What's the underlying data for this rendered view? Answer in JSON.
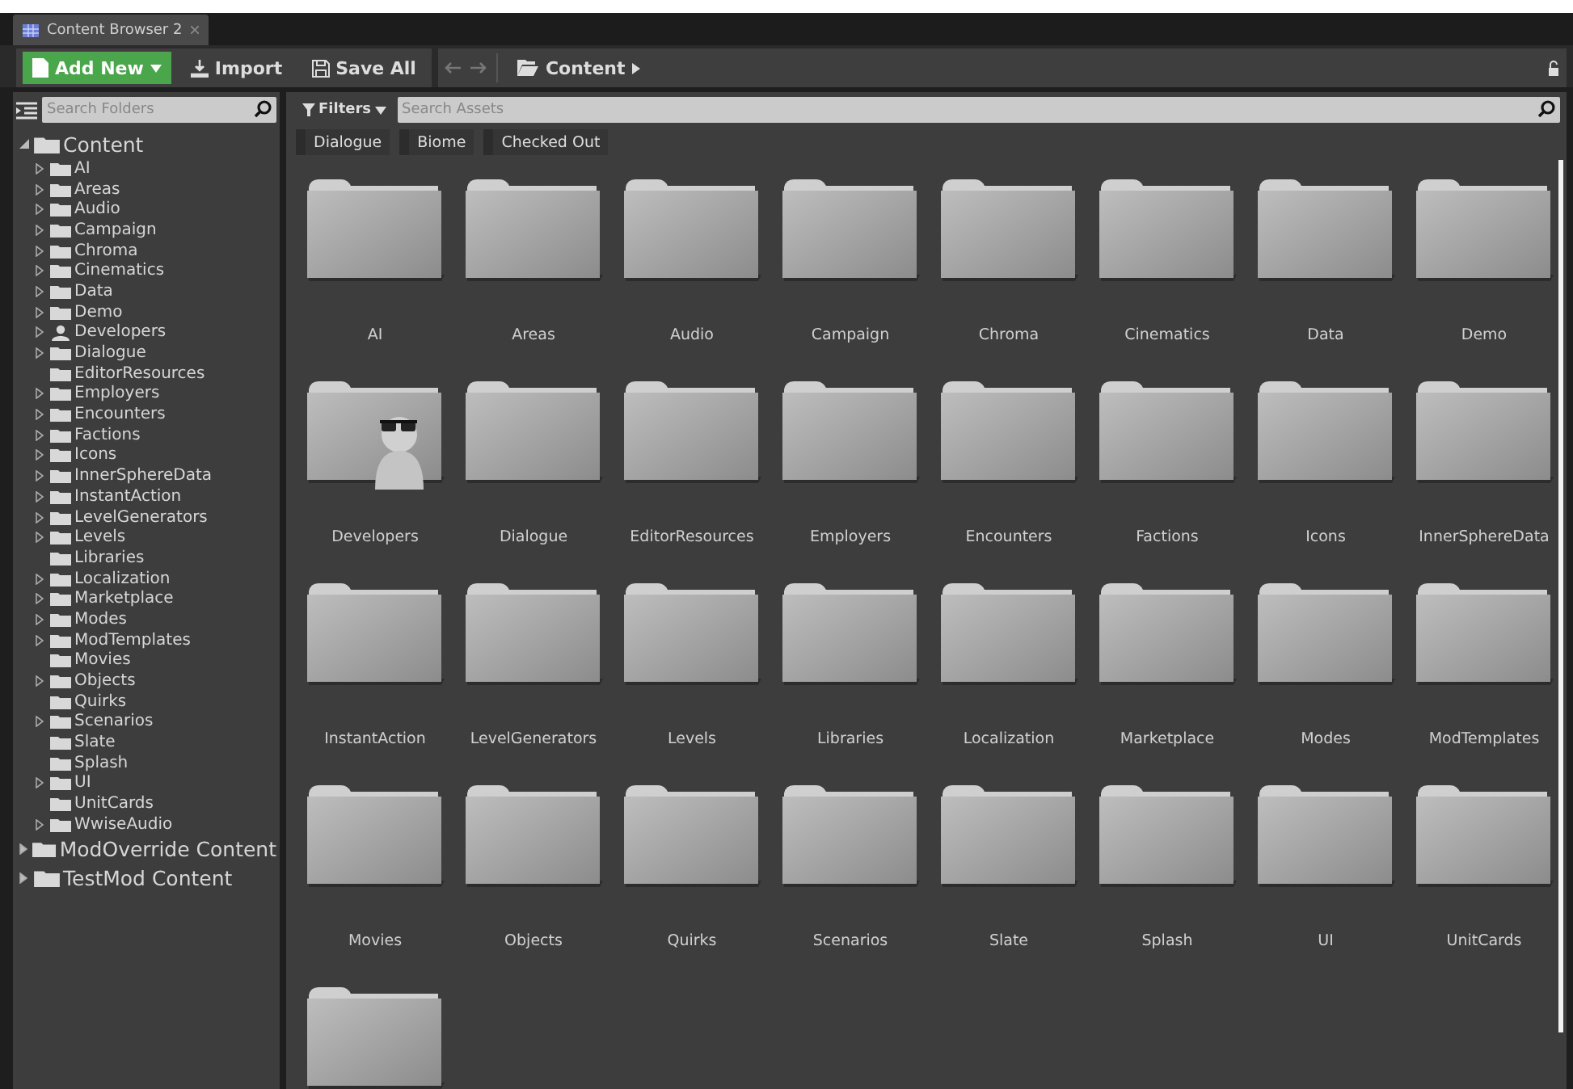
{
  "window": {
    "tab_title": "Content Browser 2"
  },
  "toolbar": {
    "add_new": "Add New",
    "import": "Import",
    "save_all": "Save All",
    "path": [
      {
        "label": "Content"
      }
    ]
  },
  "sidebar": {
    "search": {
      "placeholder": "Search Folders"
    },
    "tree": [
      {
        "label": "Content",
        "kind": "folder",
        "expanded": true,
        "children": [
          {
            "label": "AI",
            "kind": "folder",
            "expandable": true
          },
          {
            "label": "Areas",
            "kind": "folder",
            "expandable": true
          },
          {
            "label": "Audio",
            "kind": "folder",
            "expandable": true
          },
          {
            "label": "Campaign",
            "kind": "folder",
            "expandable": true
          },
          {
            "label": "Chroma",
            "kind": "folder",
            "expandable": true
          },
          {
            "label": "Cinematics",
            "kind": "folder",
            "expandable": true
          },
          {
            "label": "Data",
            "kind": "folder",
            "expandable": true
          },
          {
            "label": "Demo",
            "kind": "folder",
            "expandable": true
          },
          {
            "label": "Developers",
            "kind": "person",
            "expandable": true
          },
          {
            "label": "Dialogue",
            "kind": "folder",
            "expandable": true
          },
          {
            "label": "EditorResources",
            "kind": "folder",
            "expandable": false
          },
          {
            "label": "Employers",
            "kind": "folder",
            "expandable": true
          },
          {
            "label": "Encounters",
            "kind": "folder",
            "expandable": true
          },
          {
            "label": "Factions",
            "kind": "folder",
            "expandable": true
          },
          {
            "label": "Icons",
            "kind": "folder",
            "expandable": true
          },
          {
            "label": "InnerSphereData",
            "kind": "folder",
            "expandable": true
          },
          {
            "label": "InstantAction",
            "kind": "folder",
            "expandable": true
          },
          {
            "label": "LevelGenerators",
            "kind": "folder",
            "expandable": true
          },
          {
            "label": "Levels",
            "kind": "folder",
            "expandable": true
          },
          {
            "label": "Libraries",
            "kind": "folder",
            "expandable": false
          },
          {
            "label": "Localization",
            "kind": "folder",
            "expandable": true
          },
          {
            "label": "Marketplace",
            "kind": "folder",
            "expandable": true
          },
          {
            "label": "Modes",
            "kind": "folder",
            "expandable": true
          },
          {
            "label": "ModTemplates",
            "kind": "folder",
            "expandable": true
          },
          {
            "label": "Movies",
            "kind": "folder",
            "expandable": false
          },
          {
            "label": "Objects",
            "kind": "folder",
            "expandable": true
          },
          {
            "label": "Quirks",
            "kind": "folder",
            "expandable": false
          },
          {
            "label": "Scenarios",
            "kind": "folder",
            "expandable": true
          },
          {
            "label": "Slate",
            "kind": "folder",
            "expandable": false
          },
          {
            "label": "Splash",
            "kind": "folder",
            "expandable": false
          },
          {
            "label": "UI",
            "kind": "folder",
            "expandable": true
          },
          {
            "label": "UnitCards",
            "kind": "folder",
            "expandable": false
          },
          {
            "label": "WwiseAudio",
            "kind": "folder",
            "expandable": true
          }
        ]
      },
      {
        "label": "ModOverride Content",
        "kind": "folder",
        "expanded": false
      },
      {
        "label": "TestMod Content",
        "kind": "folder",
        "expanded": false
      }
    ]
  },
  "assets": {
    "filters": "Filters",
    "search": {
      "placeholder": "Search Assets"
    },
    "filter_chips": [
      {
        "label": "Dialogue"
      },
      {
        "label": "Biome"
      },
      {
        "label": "Checked Out"
      }
    ],
    "items": [
      {
        "label": "AI",
        "kind": "folder"
      },
      {
        "label": "Areas",
        "kind": "folder"
      },
      {
        "label": "Audio",
        "kind": "folder"
      },
      {
        "label": "Campaign",
        "kind": "folder"
      },
      {
        "label": "Chroma",
        "kind": "folder"
      },
      {
        "label": "Cinematics",
        "kind": "folder"
      },
      {
        "label": "Data",
        "kind": "folder"
      },
      {
        "label": "Demo",
        "kind": "folder"
      },
      {
        "label": "Developers",
        "kind": "developer"
      },
      {
        "label": "Dialogue",
        "kind": "folder"
      },
      {
        "label": "EditorResources",
        "kind": "folder"
      },
      {
        "label": "Employers",
        "kind": "folder"
      },
      {
        "label": "Encounters",
        "kind": "folder"
      },
      {
        "label": "Factions",
        "kind": "folder"
      },
      {
        "label": "Icons",
        "kind": "folder"
      },
      {
        "label": "InnerSphereData",
        "kind": "folder"
      },
      {
        "label": "InstantAction",
        "kind": "folder"
      },
      {
        "label": "LevelGenerators",
        "kind": "folder"
      },
      {
        "label": "Levels",
        "kind": "folder"
      },
      {
        "label": "Libraries",
        "kind": "folder"
      },
      {
        "label": "Localization",
        "kind": "folder"
      },
      {
        "label": "Marketplace",
        "kind": "folder"
      },
      {
        "label": "Modes",
        "kind": "folder"
      },
      {
        "label": "ModTemplates",
        "kind": "folder"
      },
      {
        "label": "Movies",
        "kind": "folder"
      },
      {
        "label": "Objects",
        "kind": "folder"
      },
      {
        "label": "Quirks",
        "kind": "folder"
      },
      {
        "label": "Scenarios",
        "kind": "folder"
      },
      {
        "label": "Slate",
        "kind": "folder"
      },
      {
        "label": "Splash",
        "kind": "folder"
      },
      {
        "label": "UI",
        "kind": "folder"
      },
      {
        "label": "UnitCards",
        "kind": "folder"
      },
      {
        "kind": "folder"
      }
    ]
  }
}
